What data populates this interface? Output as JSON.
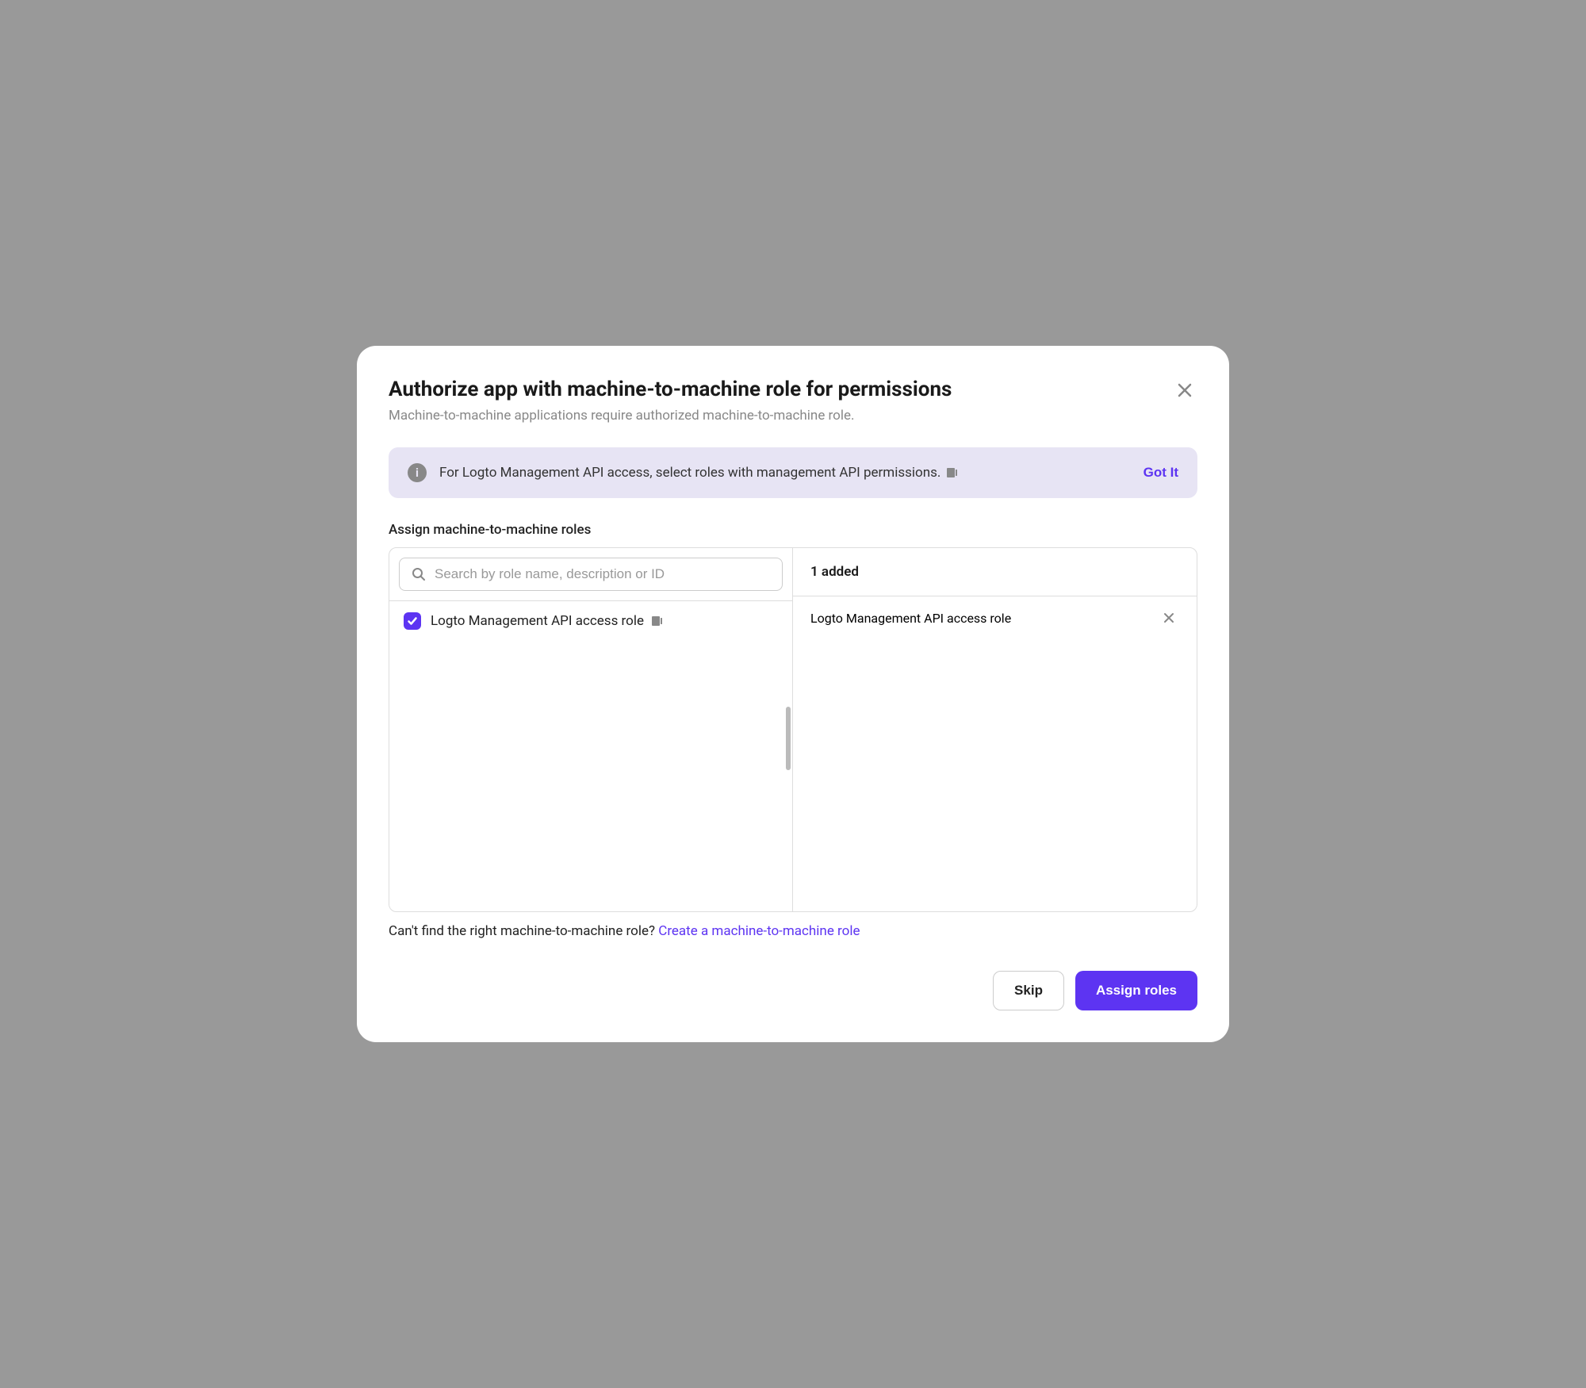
{
  "modal": {
    "title": "Authorize app with machine-to-machine role for permissions",
    "subtitle": "Machine-to-machine applications require authorized machine-to-machine role."
  },
  "banner": {
    "text": "For Logto Management API access, select roles with management API permissions.",
    "action": "Got It"
  },
  "section": {
    "label": "Assign machine-to-machine roles",
    "search_placeholder": "Search by role name, description or ID",
    "added_label": "1 added"
  },
  "roles": {
    "available": [
      {
        "name": "Logto Management API access role",
        "checked": true
      }
    ],
    "selected": [
      {
        "name": "Logto Management API access role"
      }
    ]
  },
  "helper": {
    "text": "Can't find the right machine-to-machine role? ",
    "link": "Create a machine-to-machine role"
  },
  "footer": {
    "skip": "Skip",
    "assign": "Assign roles"
  }
}
